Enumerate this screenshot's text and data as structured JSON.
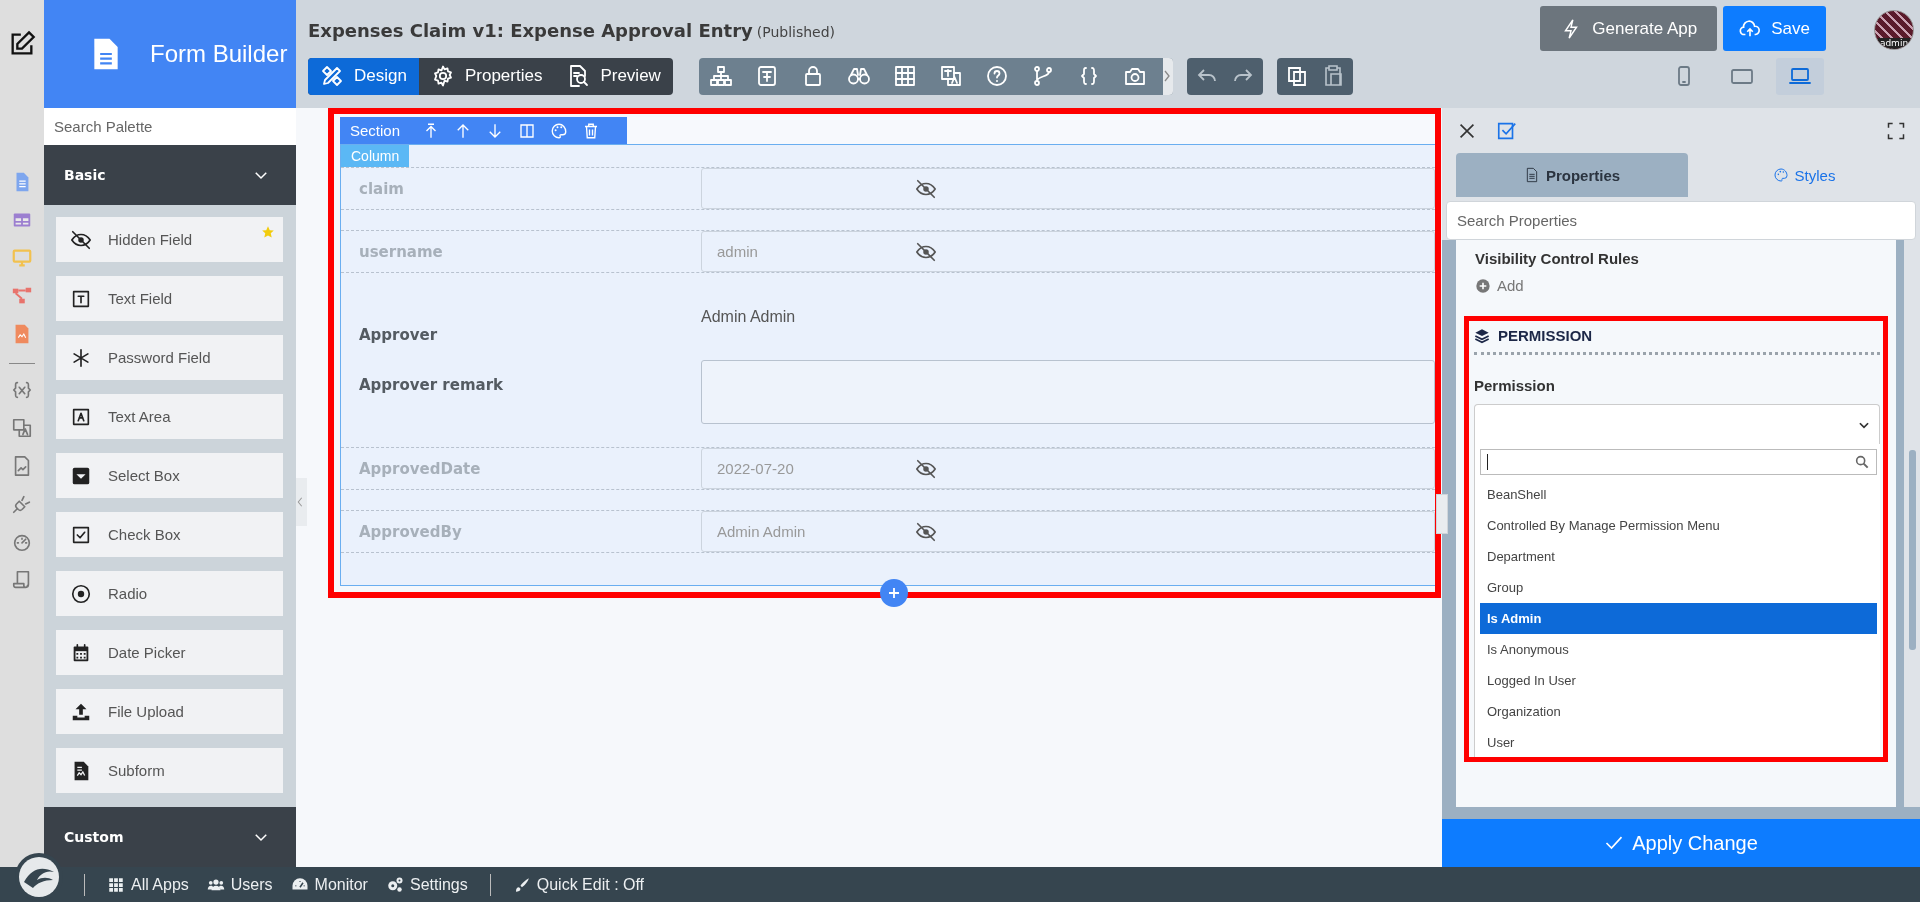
{
  "palette": {
    "title": "Form Builder",
    "search_placeholder": "Search Palette",
    "groups": [
      {
        "label": "Basic",
        "items": [
          {
            "label": "Hidden Field",
            "kind": "hidden",
            "starred": true
          },
          {
            "label": "Text Field",
            "kind": "text",
            "starred": false
          },
          {
            "label": "Password Field",
            "kind": "password",
            "starred": false
          },
          {
            "label": "Text Area",
            "kind": "textarea",
            "starred": false
          },
          {
            "label": "Select Box",
            "kind": "select",
            "starred": false
          },
          {
            "label": "Check Box",
            "kind": "checkbox",
            "starred": false
          },
          {
            "label": "Radio",
            "kind": "radio",
            "starred": false
          },
          {
            "label": "Date Picker",
            "kind": "date",
            "starred": false
          },
          {
            "label": "File Upload",
            "kind": "upload",
            "starred": false
          },
          {
            "label": "Subform",
            "kind": "subform",
            "starred": false
          }
        ]
      },
      {
        "label": "Custom"
      }
    ]
  },
  "header": {
    "title": "Expenses Claim v1: Expense Approval Entry",
    "status": "(Published)"
  },
  "mode_tabs": [
    {
      "label": "Design",
      "kind": "design",
      "selected": true
    },
    {
      "label": "Properties",
      "kind": "gear",
      "selected": false
    },
    {
      "label": "Preview",
      "kind": "preview",
      "selected": false
    }
  ],
  "actions": [
    {
      "label": "Generate App",
      "kind": "secondary"
    },
    {
      "label": "Save",
      "kind": "primary"
    }
  ],
  "avatar": {
    "label": "admin"
  },
  "devices": [
    {
      "kind": "phone",
      "selected": false
    },
    {
      "kind": "tablet",
      "selected": false
    },
    {
      "kind": "laptop",
      "selected": true
    }
  ],
  "section": {
    "label": "Section",
    "column_label": "Column",
    "fields": [
      {
        "label": "claim",
        "kind": "input",
        "hidden": true
      },
      {
        "label": "username",
        "kind": "input",
        "value": "admin",
        "hidden": true
      },
      {
        "label": "Approver",
        "kind": "text",
        "value": "Admin Admin",
        "hidden": false
      },
      {
        "label": "Approver remark",
        "kind": "textarea",
        "hidden": false
      },
      {
        "label": "ApprovedDate",
        "kind": "input",
        "value": "2022-07-20",
        "hidden": true
      },
      {
        "label": "ApprovedBy",
        "kind": "input",
        "value": "Admin Admin",
        "hidden": true
      }
    ]
  },
  "properties_panel": {
    "tabs": [
      {
        "label": "Properties",
        "kind": "doc",
        "selected": true
      },
      {
        "label": "Styles",
        "kind": "palette",
        "selected": false
      }
    ],
    "search_placeholder": "Search Properties",
    "visibility_title": "Visibility Control Rules",
    "add_label": "Add",
    "permission_heading": "PERMISSION",
    "permission_label": "Permission",
    "options": [
      {
        "label": "BeanShell",
        "selected": false
      },
      {
        "label": "Controlled By Manage Permission Menu",
        "selected": false
      },
      {
        "label": "Department",
        "selected": false
      },
      {
        "label": "Group",
        "selected": false
      },
      {
        "label": "Is Admin",
        "selected": true
      },
      {
        "label": "Is Anonymous",
        "selected": false
      },
      {
        "label": "Logged In User",
        "selected": false
      },
      {
        "label": "Organization",
        "selected": false
      },
      {
        "label": "User",
        "selected": false
      }
    ],
    "apply_label": "Apply Change"
  },
  "bottom_bar": {
    "links": [
      {
        "label": "All Apps",
        "kind": "grid"
      },
      {
        "label": "Users",
        "kind": "users"
      },
      {
        "label": "Monitor",
        "kind": "gauge"
      },
      {
        "label": "Settings",
        "kind": "gears"
      }
    ],
    "quick_edit": "Quick Edit : Off"
  }
}
